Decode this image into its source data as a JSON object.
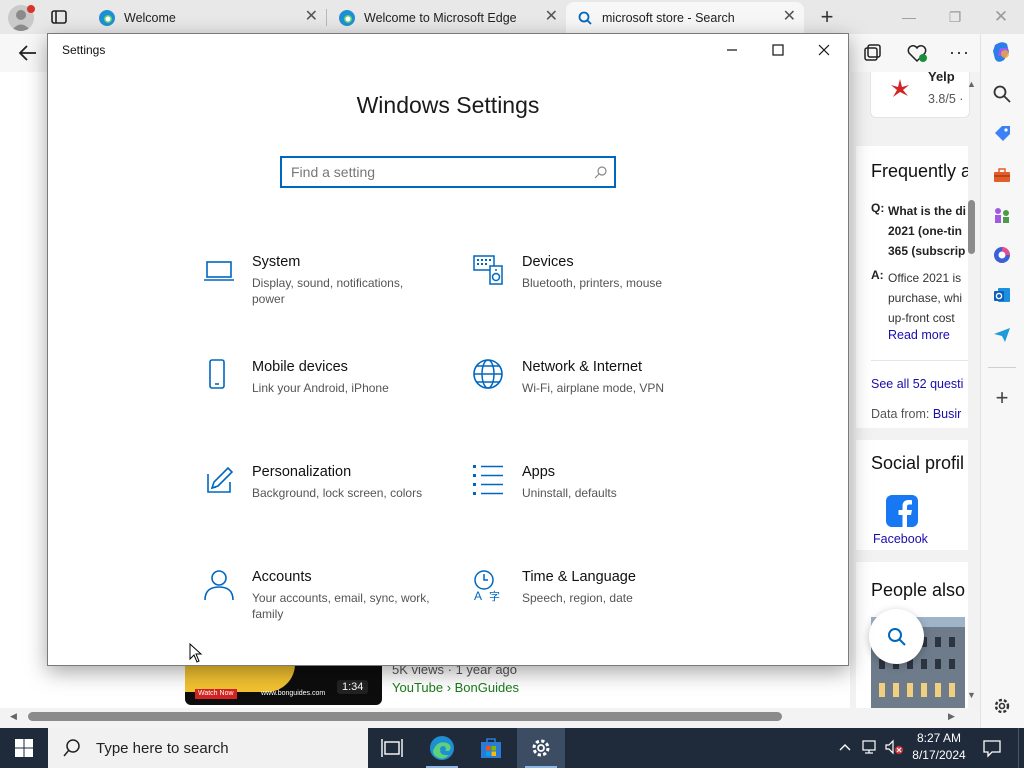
{
  "browser": {
    "tabs": [
      {
        "title": "Welcome",
        "active": false
      },
      {
        "title": "Welcome to Microsoft Edge",
        "active": false
      },
      {
        "title": "microsoft store - Search",
        "active": true
      }
    ]
  },
  "page": {
    "right_panel": {
      "yelp_name": "Yelp",
      "yelp_rating": "3.8/5 ·",
      "faq_title": "Frequently a",
      "faq_q_label": "Q:",
      "faq_q_lines": [
        "What is the di",
        "2021 (one-tin",
        "365 (subscrip"
      ],
      "faq_a_label": "A:",
      "faq_a_lines": [
        "Office 2021 is",
        "purchase, whi",
        "up-front cost"
      ],
      "read_more": "Read more",
      "see_all": "See all 52 questi",
      "data_from_label": "Data from:",
      "data_from_link": "Busir",
      "social_title": "Social profil",
      "facebook_label": "Facebook",
      "people_title": "People also"
    },
    "video": {
      "views": "5K views · 1 year ago",
      "source": "YouTube › BonGuides",
      "duration": "1:34",
      "watch_now": "Watch Now",
      "site": "www.bonguides.com"
    }
  },
  "settings": {
    "window_title": "Settings",
    "heading": "Windows Settings",
    "search_placeholder": "Find a setting",
    "categories": [
      {
        "name": "System",
        "desc": "Display, sound, notifications, power",
        "icon": "laptop-icon"
      },
      {
        "name": "Devices",
        "desc": "Bluetooth, printers, mouse",
        "icon": "devices-icon"
      },
      {
        "name": "Mobile devices",
        "desc": "Link your Android, iPhone",
        "icon": "phone-icon"
      },
      {
        "name": "Network & Internet",
        "desc": "Wi-Fi, airplane mode, VPN",
        "icon": "globe-icon"
      },
      {
        "name": "Personalization",
        "desc": "Background, lock screen, colors",
        "icon": "paint-icon"
      },
      {
        "name": "Apps",
        "desc": "Uninstall, defaults",
        "icon": "apps-list-icon"
      },
      {
        "name": "Accounts",
        "desc": "Your accounts, email, sync, work, family",
        "icon": "person-icon"
      },
      {
        "name": "Time & Language",
        "desc": "Speech, region, date",
        "icon": "time-language-icon"
      }
    ]
  },
  "taskbar": {
    "search_text": "Type here to search",
    "time": "8:27 AM",
    "date": "8/17/2024"
  },
  "colors": {
    "accent": "#0067c0",
    "taskbar": "#1f2b3a",
    "link": "#1a0dab",
    "facebook": "#1877f2"
  }
}
